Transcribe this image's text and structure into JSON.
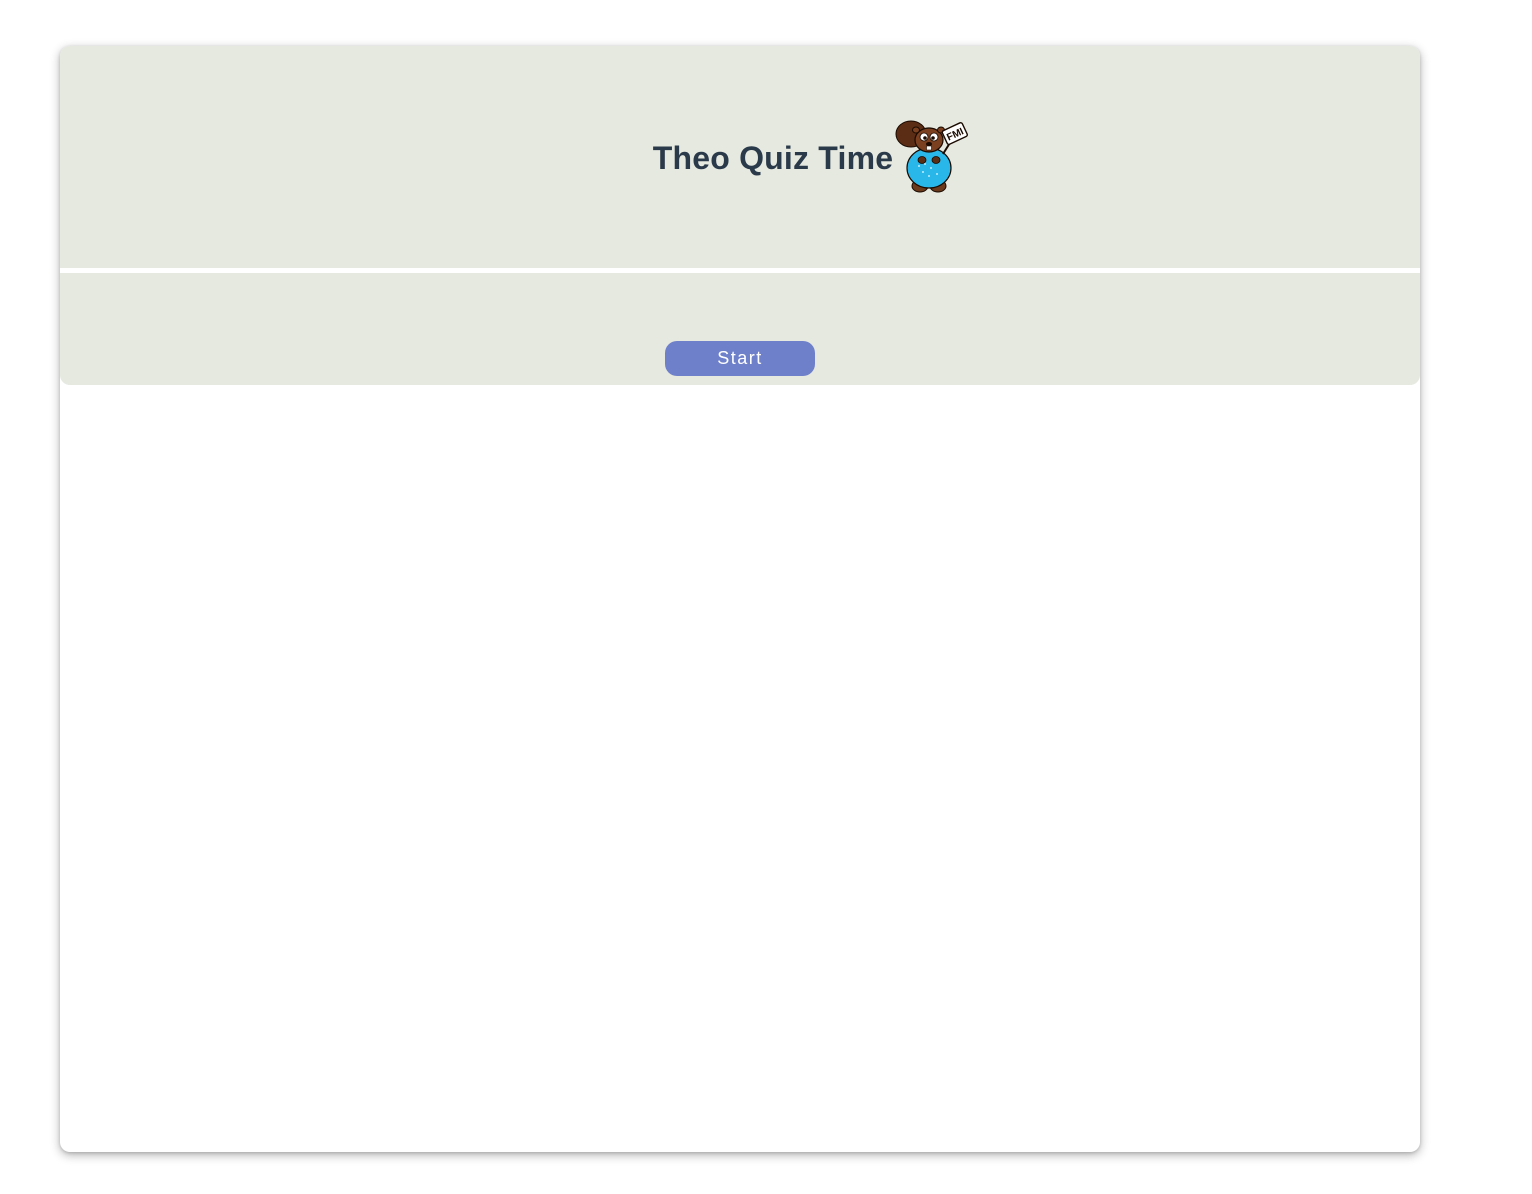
{
  "header": {
    "title": "Theo Quiz Time",
    "mascot_icon": "beaver-mascot-icon",
    "mascot_sign_text": "FMI"
  },
  "controls": {
    "start_label": "Start"
  },
  "colors": {
    "panel_background": "#e6e9e0",
    "title_text": "#2b3a4a",
    "start_button": "#6f80cb",
    "start_button_text": "#ffffff"
  }
}
